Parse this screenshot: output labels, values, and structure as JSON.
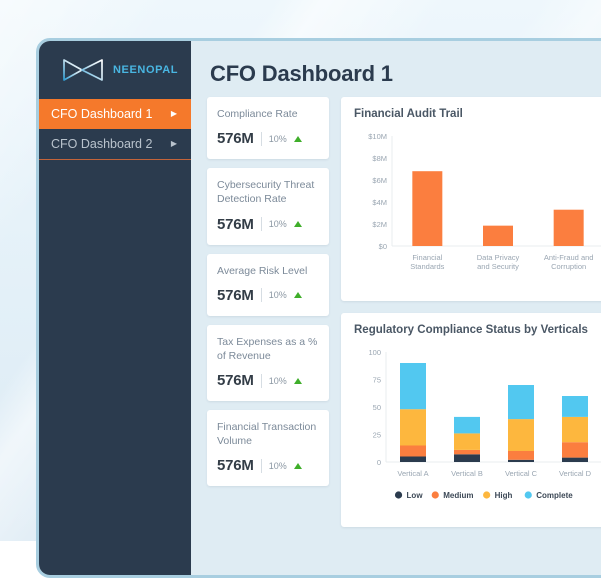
{
  "brand": {
    "name": "NEENOPAL",
    "logo_icon": "infinity-bowtie-icon",
    "accent_color": "#49b6e2"
  },
  "sidebar": {
    "items": [
      {
        "label": "CFO Dashboard 1",
        "active": true,
        "caret_icon": "chevron-right-icon"
      },
      {
        "label": "CFO Dashboard 2",
        "active": false,
        "caret_icon": "chevron-right-icon"
      }
    ],
    "active_color": "#f5792b",
    "background_color": "#2b3b4e"
  },
  "header": {
    "title": "CFO Dashboard 1"
  },
  "kpis": [
    {
      "label": "Compliance Rate",
      "value": "576M",
      "delta": "10%",
      "trend_icon": "triangle-up-icon",
      "trend_color": "#3fae2a"
    },
    {
      "label": "Cybersecurity Threat Detection Rate",
      "value": "576M",
      "delta": "10%",
      "trend_icon": "triangle-up-icon",
      "trend_color": "#3fae2a"
    },
    {
      "label": "Average Risk Level",
      "value": "576M",
      "delta": "10%",
      "trend_icon": "triangle-up-icon",
      "trend_color": "#3fae2a"
    },
    {
      "label": "Tax Expenses as a % of Revenue",
      "value": "576M",
      "delta": "10%",
      "trend_icon": "triangle-up-icon",
      "trend_color": "#3fae2a"
    },
    {
      "label": "Financial Transaction Volume",
      "value": "576M",
      "delta": "10%",
      "trend_icon": "triangle-up-icon",
      "trend_color": "#3fae2a"
    }
  ],
  "chart_data": [
    {
      "type": "bar",
      "title": "Financial Audit Trail",
      "categories": [
        "Financial Standards",
        "Data Privacy and Security",
        "Anti-Fraud and Corruption"
      ],
      "values": [
        6.8,
        1.85,
        3.3
      ],
      "xlabel": "",
      "ylabel": "",
      "ylim": [
        0,
        10
      ],
      "yticks": [
        0,
        2,
        4,
        6,
        8,
        10
      ],
      "ytick_labels": [
        "$0",
        "$2M",
        "$4M",
        "$6M",
        "$8M",
        "$10M"
      ],
      "grid": false,
      "legend": "none",
      "bar_color": "#fb7e3f"
    },
    {
      "type": "bar",
      "stacked": true,
      "title": "Regulatory Compliance Status by Verticals",
      "categories": [
        "Vertical A",
        "Vertical B",
        "Vertical C",
        "Vertical D"
      ],
      "series": [
        {
          "name": "Low",
          "color": "#2b3b4e",
          "values": [
            5,
            7,
            2,
            4
          ]
        },
        {
          "name": "Medium",
          "color": "#fb7e3f",
          "values": [
            10,
            4,
            8,
            14
          ]
        },
        {
          "name": "High",
          "color": "#fdb73e",
          "values": [
            33,
            15,
            29,
            23
          ]
        },
        {
          "name": "Complete",
          "color": "#52c8f0",
          "values": [
            42,
            15,
            31,
            19
          ]
        }
      ],
      "xlabel": "",
      "ylabel": "",
      "ylim": [
        0,
        100
      ],
      "yticks": [
        0,
        25,
        50,
        75,
        100
      ],
      "ytick_labels": [
        "0",
        "25",
        "50",
        "75",
        "100"
      ],
      "grid": false,
      "legend": "bottom"
    }
  ]
}
